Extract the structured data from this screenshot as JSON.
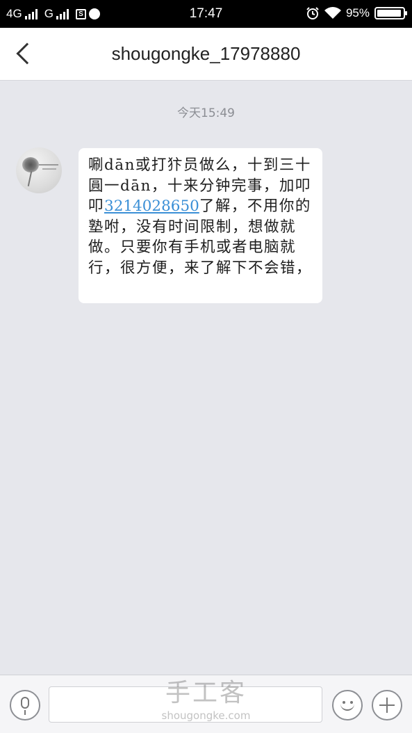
{
  "status_bar": {
    "net1": "4G",
    "net2": "G",
    "sim_icon_letter": "S",
    "time": "17:47",
    "battery_percent": "95%",
    "battery_level": 0.95
  },
  "header": {
    "title": "shougongke_17978880"
  },
  "chat": {
    "timestamp": "今天15:49",
    "message": {
      "text_before": "唰dān或打犿员做么，十到三十圓一dān，十来分钟完事，加叩叩",
      "link": "3214028650",
      "text_after": "了解，不用你的塾咐，没有时间限制，想做就做。只要你有手机或者电脑就行，很方便，来了解下不会错，"
    }
  },
  "input_bar": {
    "input_value": ""
  },
  "watermark": {
    "logo_text": "手工客",
    "url": "shougongke.com"
  },
  "colors": {
    "background": "#e6e7ec",
    "link": "#3a8fd6",
    "status_bar": "#000000"
  },
  "icons": [
    "back-icon",
    "mic-icon",
    "emoji-icon",
    "plus-icon",
    "wifi-icon",
    "alarm-icon",
    "battery-icon"
  ]
}
